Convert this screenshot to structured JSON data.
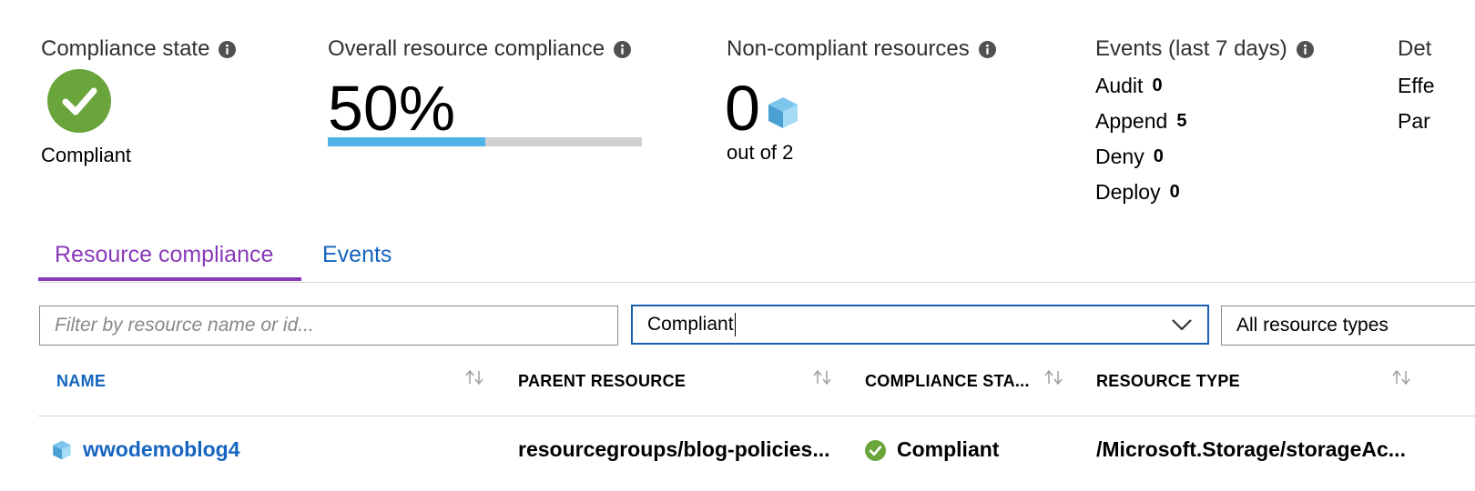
{
  "summary": {
    "compliance_state": {
      "title": "Compliance state",
      "value": "Compliant",
      "color": "#6aa53c"
    },
    "overall_compliance": {
      "title": "Overall resource compliance",
      "percent_label": "50%",
      "percent_value": 50,
      "bar_color": "#4fb3e8"
    },
    "non_compliant": {
      "title": "Non-compliant resources",
      "count": "0",
      "out_of": "out of 2"
    },
    "events": {
      "title": "Events (last 7 days)",
      "rows": [
        {
          "label": "Audit",
          "value": "0"
        },
        {
          "label": "Append",
          "value": "5"
        },
        {
          "label": "Deny",
          "value": "0"
        },
        {
          "label": "Deploy",
          "value": "0"
        }
      ]
    },
    "details_clipped": {
      "title": "Det",
      "row1": "Effe",
      "row2": "Par"
    }
  },
  "tabs": [
    {
      "label": "Resource compliance",
      "active": true
    },
    {
      "label": "Events",
      "active": false
    }
  ],
  "filters": {
    "search_placeholder": "Filter by resource name or id...",
    "compliance_value": "Compliant",
    "resource_type_value": "All resource types"
  },
  "table": {
    "columns": [
      "NAME",
      "PARENT RESOURCE",
      "COMPLIANCE STA...",
      "RESOURCE TYPE"
    ],
    "rows": [
      {
        "name": "wwodemoblog4",
        "parent": "resourcegroups/blog-policies...",
        "status": "Compliant",
        "type": "/Microsoft.Storage/storageAc..."
      }
    ]
  },
  "icons": {
    "info": "info-icon",
    "check": "check-icon",
    "cube": "storage-cube-icon",
    "chevron": "chevron-down-icon",
    "sort": "sort-icon"
  }
}
